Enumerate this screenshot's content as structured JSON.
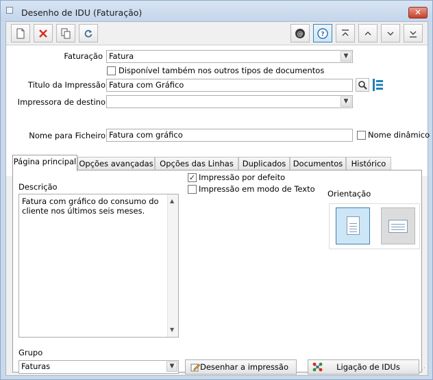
{
  "window": {
    "title": "Desenho de IDU (Faturação)",
    "close_glyph": "✕"
  },
  "toolbar": {
    "buttons": [
      {
        "name": "new-document-icon",
        "glyph": "🗋"
      },
      {
        "name": "delete-icon",
        "glyph": "✕"
      },
      {
        "name": "copy-icon",
        "glyph": "⧉"
      },
      {
        "name": "refresh-icon",
        "glyph": "⟳"
      },
      {
        "name": "at-icon",
        "glyph": "@"
      },
      {
        "name": "help-icon",
        "glyph": "?"
      },
      {
        "name": "first-record-icon",
        "glyph": "⤒"
      },
      {
        "name": "previous-record-icon",
        "glyph": "⌃"
      },
      {
        "name": "next-record-icon",
        "glyph": "⌄"
      },
      {
        "name": "last-record-icon",
        "glyph": "⤓"
      }
    ]
  },
  "form": {
    "faturacao_label": "Faturação",
    "faturacao_value": "Fatura",
    "disponivel_label": "Disponível também nos outros tipos de documentos",
    "disponivel_checked": false,
    "titulo_label": "Titulo da Impressão",
    "titulo_value": "Fatura com Gráfico",
    "impressora_label": "Impressora de destino",
    "impressora_value": "",
    "nome_ficheiro_label": "Nome para Ficheiro",
    "nome_ficheiro_value": "Fatura com gráfico",
    "nome_dinamico_label": "Nome dinâmico",
    "nome_dinamico_checked": false
  },
  "tabs": [
    {
      "label": "Página principal",
      "active": true
    },
    {
      "label": "Opções avançadas",
      "active": false
    },
    {
      "label": "Opções das Linhas",
      "active": false
    },
    {
      "label": "Duplicados",
      "active": false
    },
    {
      "label": "Documentos",
      "active": false
    },
    {
      "label": "Histórico",
      "active": false
    }
  ],
  "main": {
    "descricao_label": "Descrição",
    "descricao_value": "Fatura com gráfico do consumo do cliente nos últimos seis meses.",
    "impressao_defeito_label": "Impressão por defeito",
    "impressao_defeito_checked": true,
    "impressao_texto_label": "Impressão em modo de Texto",
    "impressao_texto_checked": false,
    "orientacao_label": "Orientação",
    "orientation_selected": "portrait",
    "grupo_label": "Grupo",
    "grupo_value": "Faturas",
    "desenhar_label": "Desenhar a impressão",
    "ligacao_label": "Ligação de IDUs"
  },
  "colors": {
    "accent": "#3c7fb1",
    "delete_red": "#d62c1f",
    "title_bg": "#c9d9ec"
  }
}
